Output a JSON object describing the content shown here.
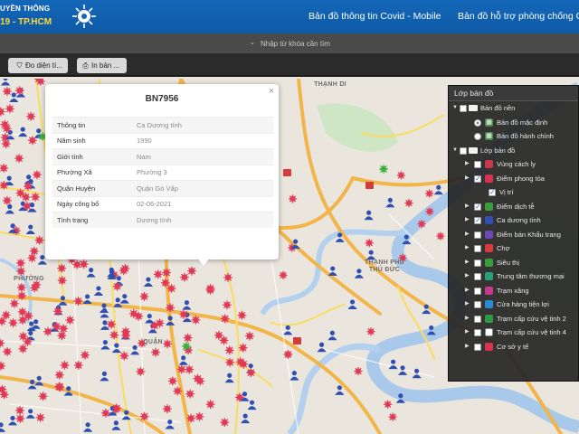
{
  "header": {
    "brand_line1": "UYỀN THÔNG",
    "brand_line2": "19 - TP.HCM",
    "nav": [
      {
        "label": "Bản đồ thông tin Covid - Mobile"
      },
      {
        "label": "Bản đồ hỗ trợ phòng chống Co"
      }
    ],
    "bg_color": "#1266b6",
    "accent_color": "#ffd83a"
  },
  "search": {
    "placeholder": "Nhập từ khóa cần tìm"
  },
  "toolbar": {
    "buttons": [
      {
        "label": "",
        "icon": "menu-icon"
      },
      {
        "label": "Đo diện tí...",
        "icon": "ruler-icon"
      },
      {
        "label": "In bản ...",
        "icon": "printer-icon"
      }
    ]
  },
  "popup": {
    "title": "BN7956",
    "rows": [
      {
        "key": "Thông tin",
        "value": "Ca Dương tính"
      },
      {
        "key": "Năm sinh",
        "value": "1990"
      },
      {
        "key": "Giới tính",
        "value": "Nam"
      },
      {
        "key": "Phường Xã",
        "value": "Phường 3"
      },
      {
        "key": "Quận Huyện",
        "value": "Quận Gò Vấp"
      },
      {
        "key": "Ngày công bố",
        "value": "02-06-2021"
      },
      {
        "key": "Tình trạng",
        "value": "Dương tính"
      }
    ]
  },
  "map": {
    "labels": [
      {
        "text": "THẠNH DI"
      },
      {
        "text": "THẠNH PHÚ THỦ ĐỨC"
      },
      {
        "text": "PHƯỜNG"
      },
      {
        "text": "QUẬN"
      }
    ],
    "marker_colors": {
      "positive": "#e23a56",
      "person": "#2f4fb1",
      "green": "#3fae3f"
    }
  },
  "layers": {
    "title": "Lớp bản đồ",
    "items": [
      {
        "label": "Bản đồ nền",
        "kind": "folder",
        "indent": 0
      },
      {
        "label": "Bản đồ mặc định",
        "kind": "radio",
        "checked": true,
        "indent": 1,
        "icon_color": "#4a8a4a"
      },
      {
        "label": "Bản đồ hành chính",
        "kind": "radio",
        "checked": false,
        "indent": 1,
        "icon_color": "#4a8a4a"
      },
      {
        "label": "Lớp bản đồ",
        "kind": "folder",
        "indent": 0
      },
      {
        "label": "Vùng cách ly",
        "kind": "check",
        "checked": false,
        "indent": 1,
        "icon_color": "#c9374a",
        "icon": "quarantine-zone-icon"
      },
      {
        "label": "Điểm phong tỏa",
        "kind": "check",
        "checked": true,
        "indent": 1,
        "icon_color": "#d8334e",
        "icon": "lockdown-virus-icon"
      },
      {
        "label": "Vị trí",
        "kind": "check",
        "checked": true,
        "indent": 3,
        "icon_color": "",
        "icon": ""
      },
      {
        "label": "Điểm dịch tễ",
        "kind": "check",
        "checked": true,
        "indent": 1,
        "icon_color": "#3b9c3b",
        "icon": "epidemic-point-icon"
      },
      {
        "label": "Ca dương tính",
        "kind": "check",
        "checked": true,
        "indent": 1,
        "icon_color": "#2f4fb1",
        "icon": "positive-case-icon"
      },
      {
        "label": "Điểm bán Khẩu trang",
        "kind": "check",
        "checked": false,
        "indent": 1,
        "icon_color": "#6a4bb5",
        "icon": "mask-shop-icon"
      },
      {
        "label": "Chợ",
        "kind": "check",
        "checked": false,
        "indent": 1,
        "icon_color": "#d83a3a",
        "icon": "market-icon"
      },
      {
        "label": "Siêu thị",
        "kind": "check",
        "checked": false,
        "indent": 1,
        "icon_color": "#3b9c3b",
        "icon": "supermarket-icon"
      },
      {
        "label": "Trung tâm thương mại",
        "kind": "check",
        "checked": false,
        "indent": 1,
        "icon_color": "#2aa07a",
        "icon": "mall-icon"
      },
      {
        "label": "Trạm xăng",
        "kind": "check",
        "checked": false,
        "indent": 1,
        "icon_color": "#c43a8c",
        "icon": "gas-station-icon"
      },
      {
        "label": "Cửa hàng tiện lợi",
        "kind": "check",
        "checked": false,
        "indent": 1,
        "icon_color": "#2c8ad6",
        "icon": "convenience-store-icon"
      },
      {
        "label": "Trạm cấp cứu vệ tinh 2",
        "kind": "check",
        "checked": false,
        "indent": 1,
        "icon_color": "#2f9a45",
        "icon": "emergency-station-icon"
      },
      {
        "label": "Trạm cấp cứu vệ tinh 4",
        "kind": "check",
        "checked": false,
        "indent": 1,
        "icon_color": "#ffffff",
        "icon": "emergency-station-4-icon"
      },
      {
        "label": "Cơ sở y tế",
        "kind": "check",
        "checked": false,
        "indent": 1,
        "icon_color": "#d8334e",
        "icon": "medical-facility-icon"
      }
    ]
  }
}
